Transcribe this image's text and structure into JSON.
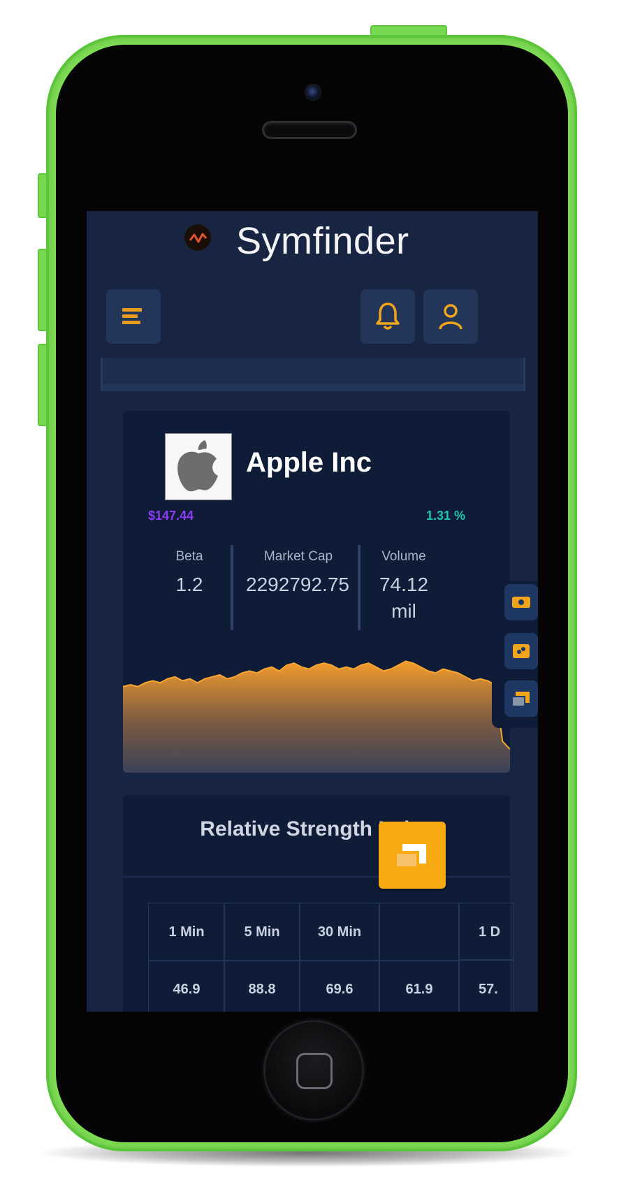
{
  "app": {
    "title": "Symfinder",
    "icons": {
      "logo": "symfinder-logo",
      "menu": "menu-icon",
      "bell": "bell-icon",
      "user": "user-icon"
    }
  },
  "stock": {
    "name": "Apple Inc",
    "logo": "apple-logo-icon",
    "price": "$147.44",
    "change": "1.31 %",
    "colors": {
      "price": "#8a3cf2",
      "change": "#1ec3b2",
      "accent": "#f7aa12",
      "background": "#172543"
    },
    "stats": [
      {
        "label": "Beta",
        "value": "1.2"
      },
      {
        "label": "Market Cap",
        "value": "2292792.75"
      },
      {
        "label": "Volume",
        "value": "74.12 mil"
      }
    ]
  },
  "chart_data": {
    "type": "area",
    "title": "",
    "xlabel": "",
    "ylabel": "",
    "values": [
      22,
      22.5,
      22,
      23,
      23.5,
      23,
      24,
      24.5,
      23.5,
      24,
      23,
      24,
      24.5,
      25,
      24,
      24.5,
      25.5,
      26,
      25.5,
      26.5,
      27,
      26,
      27.5,
      28,
      27,
      26.5,
      27.5,
      28,
      27.5,
      26.5,
      27,
      26.5,
      27.5,
      28,
      27,
      26,
      26.5,
      27.5,
      28.5,
      28,
      27,
      26,
      25.5,
      26.5,
      26,
      25.5,
      24.5,
      23.5,
      24,
      23.5,
      22.5,
      8,
      6
    ],
    "ylim": [
      0,
      30
    ],
    "color": "#f7a533",
    "grid": false
  },
  "rsi": {
    "title": "Relative Strength Index",
    "columns": [
      {
        "label": "1 Min",
        "value": "46.9"
      },
      {
        "label": "5 Min",
        "value": "88.8"
      },
      {
        "label": "30 Min",
        "value": "69.6"
      },
      {
        "label": "",
        "value": "61.9"
      },
      {
        "label": "1 D",
        "value": "57."
      }
    ]
  },
  "side_tools": [
    "eye-icon",
    "link-icon",
    "screen-icon"
  ],
  "fab_icon": "screen-icon"
}
